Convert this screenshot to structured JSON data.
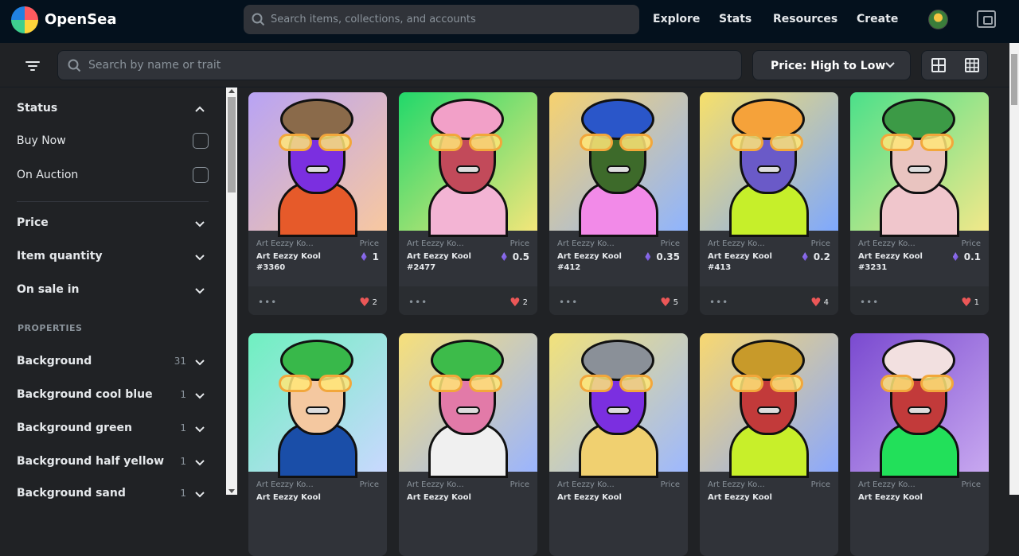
{
  "header": {
    "brand": "OpenSea",
    "search_placeholder": "Search items, collections, and accounts",
    "nav": [
      "Explore",
      "Stats",
      "Resources",
      "Create"
    ]
  },
  "toolbar": {
    "search_placeholder": "Search by name or trait",
    "sort_label": "Price: High to Low"
  },
  "sidebar": {
    "status_title": "Status",
    "status_options": [
      "Buy Now",
      "On Auction"
    ],
    "sections": [
      "Price",
      "Item quantity",
      "On sale in"
    ],
    "properties_label": "PROPERTIES",
    "properties": [
      {
        "name": "Background",
        "count": "31"
      },
      {
        "name": "Background cool blue",
        "count": "1"
      },
      {
        "name": "Background green",
        "count": "1"
      },
      {
        "name": "Background half yellow",
        "count": "1"
      },
      {
        "name": "Background sand",
        "count": "1"
      }
    ]
  },
  "cards": [
    {
      "collection": "Art Eezzy Ko...",
      "price_label": "Price",
      "name": "Art Eezzy Kool #3360",
      "price": "1",
      "favorites": "2",
      "bg": [
        "#b8a3f5",
        "#f8c8a0"
      ],
      "face": "#7b2fe0",
      "hair": "#8a6a4a",
      "shirt": "#e65a2a"
    },
    {
      "collection": "Art Eezzy Ko...",
      "price_label": "Price",
      "name": "Art Eezzy Kool #2477",
      "price": "0.5",
      "favorites": "2",
      "bg": [
        "#21d86a",
        "#f3e67a"
      ],
      "face": "#c24a5a",
      "hair": "#f2a0c8",
      "shirt": "#f3b4d4"
    },
    {
      "collection": "Art Eezzy Ko...",
      "price_label": "Price",
      "name": "Art Eezzy Kool #412",
      "price": "0.35",
      "favorites": "5",
      "bg": [
        "#f7d26e",
        "#8fb4ff"
      ],
      "face": "#3d6a2a",
      "hair": "#2a56c9",
      "shirt": "#f28ae8"
    },
    {
      "collection": "Art Eezzy Ko...",
      "price_label": "Price",
      "name": "Art Eezzy Kool #413",
      "price": "0.2",
      "favorites": "4",
      "bg": [
        "#f7e06a",
        "#7ea8ff"
      ],
      "face": "#6a5ac8",
      "hair": "#f5a23a",
      "shirt": "#c6ef2a"
    },
    {
      "collection": "Art Eezzy Ko...",
      "price_label": "Price",
      "name": "Art Eezzy Kool #3231",
      "price": "0.1",
      "favorites": "1",
      "bg": [
        "#4be08a",
        "#f2e88a"
      ],
      "face": "#e9c4c0",
      "hair": "#3c9a46",
      "shirt": "#f0c6cc"
    },
    {
      "collection": "Art Eezzy Ko...",
      "price_label": "Price",
      "name": "Art Eezzy Kool",
      "price": "",
      "favorites": "",
      "bg": [
        "#6ff0c0",
        "#c9d8ff"
      ],
      "face": "#f4c8a0",
      "hair": "#38b84a",
      "shirt": "#1a4ea8"
    },
    {
      "collection": "Art Eezzy Ko...",
      "price_label": "Price",
      "name": "Art Eezzy Kool",
      "price": "",
      "favorites": "",
      "bg": [
        "#f7e07a",
        "#9ab4ff"
      ],
      "face": "#e27aa8",
      "hair": "#3dbb4a",
      "shirt": "#f0f0f0"
    },
    {
      "collection": "Art Eezzy Ko...",
      "price_label": "Price",
      "name": "Art Eezzy Kool",
      "price": "",
      "favorites": "",
      "bg": [
        "#f2e27a",
        "#9db8ff"
      ],
      "face": "#7b2fe0",
      "hair": "#8a9098",
      "shirt": "#f0d070"
    },
    {
      "collection": "Art Eezzy Ko...",
      "price_label": "Price",
      "name": "Art Eezzy Kool",
      "price": "",
      "favorites": "",
      "bg": [
        "#f8d870",
        "#8aa8ff"
      ],
      "face": "#c23a3a",
      "hair": "#c89a2a",
      "shirt": "#c8ef2a"
    },
    {
      "collection": "Art Eezzy Ko...",
      "price_label": "Price",
      "name": "Art Eezzy Kool",
      "price": "",
      "favorites": "",
      "bg": [
        "#7a4ad0",
        "#c8a8f0"
      ],
      "face": "#c23a3a",
      "hair": "#f2e0e0",
      "shirt": "#22e05a"
    }
  ],
  "colors": {
    "topbar": "#04111d",
    "panel": "#303339",
    "heart": "#eb5757",
    "eth": "#8a6ef0"
  }
}
